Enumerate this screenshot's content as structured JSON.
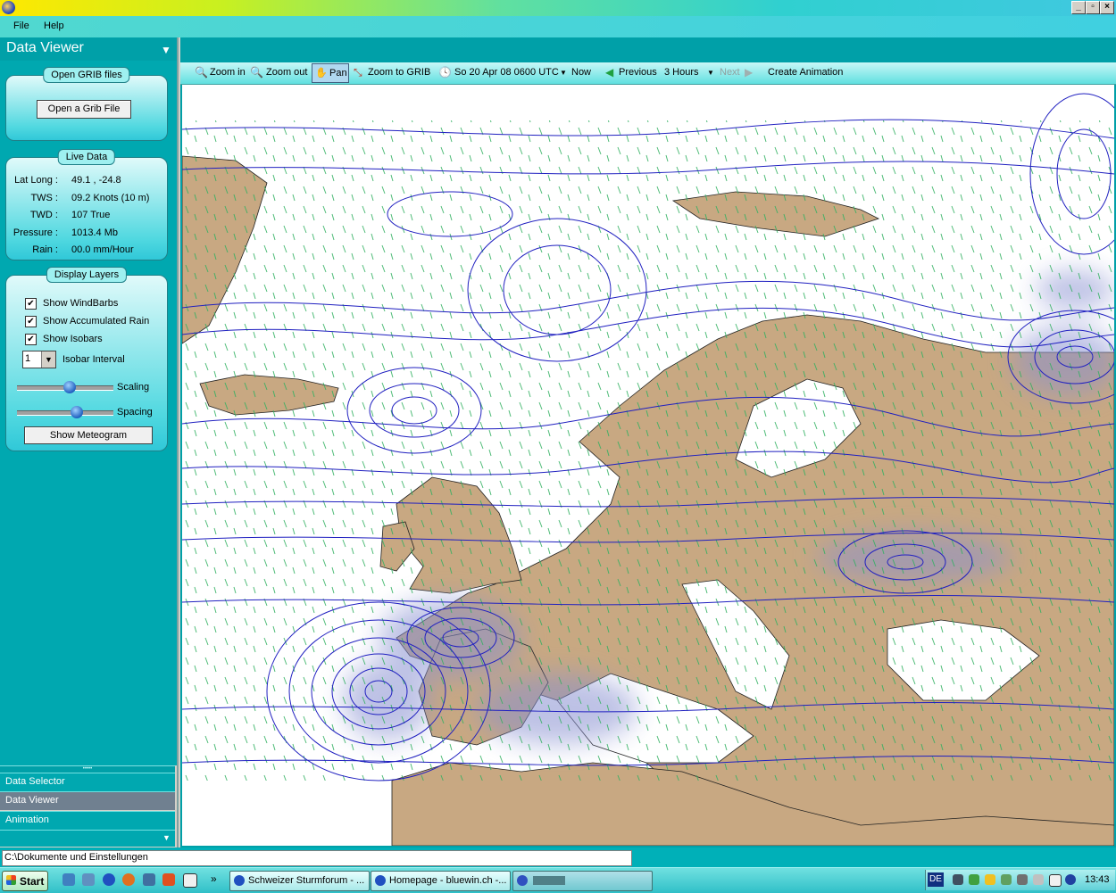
{
  "window": {
    "min": "_",
    "restore": "▫",
    "close": "×"
  },
  "menu": {
    "file": "File",
    "help": "Help"
  },
  "sidebar": {
    "title": "Data Viewer",
    "open_group": {
      "title": "Open GRIB files",
      "button": "Open a Grib File"
    },
    "live_group": {
      "title": "Live Data",
      "rows": [
        {
          "label": "Lat Long :",
          "value": "49.1 ,  -24.8"
        },
        {
          "label": "TWS :",
          "value": "09.2 Knots (10 m)"
        },
        {
          "label": "TWD :",
          "value": "107 True"
        },
        {
          "label": "Pressure :",
          "value": "1013.4 Mb"
        },
        {
          "label": "Rain :",
          "value": "00.0 mm/Hour"
        }
      ]
    },
    "layers_group": {
      "title": "Display Layers",
      "checks": [
        {
          "label": "Show WindBarbs",
          "checked": "✔"
        },
        {
          "label": "Show Accumulated Rain",
          "checked": "✔"
        },
        {
          "label": "Show Isobars",
          "checked": "✔"
        }
      ],
      "isobar_value": "1",
      "isobar_label": "Isobar Interval",
      "scaling_label": "Scaling",
      "scaling_level": 0.55,
      "spacing_label": "Spacing",
      "spacing_level": 0.62,
      "meteogram_button": "Show Meteogram"
    },
    "nav": [
      "Data Selector",
      "Data Viewer",
      "Animation"
    ]
  },
  "toolbar": {
    "zoom_in": "Zoom in",
    "zoom_out": "Zoom out",
    "pan": "Pan",
    "zoom_grib": "Zoom to GRIB",
    "datetime": "So 20 Apr 08 0600 UTC",
    "now": "Now",
    "previous": "Previous",
    "step": "3 Hours",
    "next": "Next",
    "animation": "Create Animation"
  },
  "status": {
    "path": "C:\\Dokumente und Einstellungen"
  },
  "taskbar": {
    "start": "Start",
    "expand": "»",
    "tasks": [
      "Schweizer Sturmforum - ...",
      "Homepage - bluewin.ch -..."
    ],
    "lang": "DE",
    "clock": "13:43"
  },
  "colors": {
    "land": "#c8a882",
    "isobar": "#2020c0",
    "rain": "#8890d0",
    "accent": "#00a8b0"
  }
}
